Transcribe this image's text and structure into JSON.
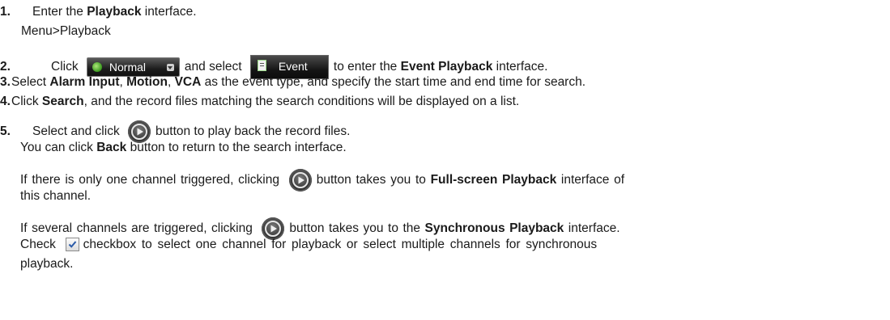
{
  "step1": {
    "num": "1.",
    "pre": "Enter the ",
    "bold": "Playback",
    "post": " interface.",
    "path": "Menu>Playback"
  },
  "step2": {
    "num": "2.",
    "t1": "Click",
    "normal_label": "Normal",
    "t2": "and select",
    "event_label": "Event",
    "t3": "to enter the ",
    "bold": "Event Playback",
    "t4": " interface."
  },
  "step3": {
    "num": "3.",
    "t1": "Select ",
    "b1": "Alarm Input",
    "t2": ", ",
    "b2": "Motion",
    "t3": ", ",
    "b3": "VCA",
    "t4": " as the event type, and specify the start time and end time for search."
  },
  "step4": {
    "num": "4.",
    "t1": "Click ",
    "b1": "Search",
    "t2": ", and the record files matching the search conditions will be displayed on a list."
  },
  "step5": {
    "num": "5.",
    "t1": "Select and click",
    "t2": "button to play back the record files.",
    "back": {
      "t1": "You can click ",
      "b1": "Back",
      "t2": " button to return to the search interface."
    },
    "single": {
      "t1": "If there is only one channel triggered, clicking",
      "t2": "button takes you to ",
      "b1": "Full-screen Playback",
      "t3": " interface of",
      "t4": "this channel."
    },
    "several": {
      "t1": "If several channels are triggered, clicking",
      "t2": "button takes you to the ",
      "b1": "Synchronous Playback",
      "t3": " interface.",
      "t4": "Check",
      "t5": "checkbox to select one channel for playback or select multiple channels for synchronous",
      "t6": "playback."
    }
  },
  "icons": {
    "play": "play-icon",
    "checkbox": "checkbox-checked-icon",
    "normal_dot": "green-dot-icon",
    "dropdown": "chevron-down-icon",
    "event": "document-icon"
  },
  "colors": {
    "button_dark": "#1d1d1d",
    "dot_green": "#3a9a1e",
    "text": "#1a1a1a"
  }
}
